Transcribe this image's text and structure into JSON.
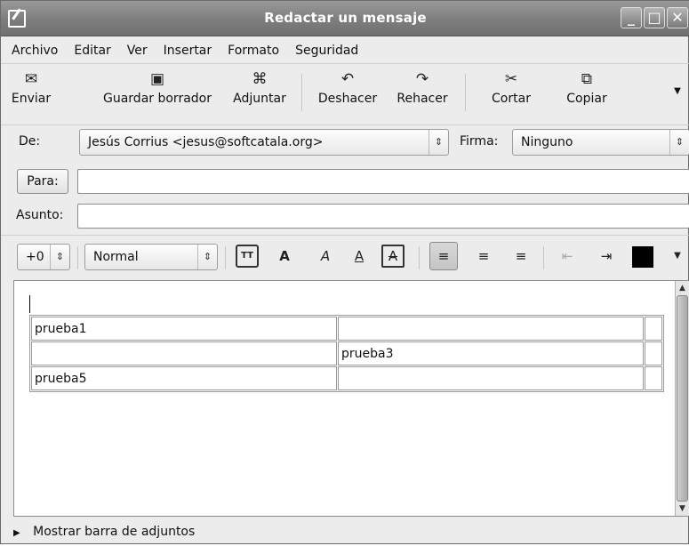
{
  "window": {
    "title": "Redactar un mensaje",
    "controls": {
      "minimize": "_",
      "maximize": "□",
      "close": "✕"
    }
  },
  "menu": [
    "Archivo",
    "Editar",
    "Ver",
    "Insertar",
    "Formato",
    "Seguridad"
  ],
  "toolbar": {
    "send": "Enviar",
    "save_draft": "Guardar borrador",
    "attach": "Adjuntar",
    "undo": "Deshacer",
    "redo": "Rehacer",
    "cut": "Cortar",
    "copy": "Copiar"
  },
  "header": {
    "from_label": "De:",
    "from_value": "Jesús Corrius <jesus@softcatala.org>",
    "signature_label": "Firma:",
    "signature_value": "Ninguno",
    "to_label": "Para:",
    "to_value": "",
    "subject_label": "Asunto:",
    "subject_value": ""
  },
  "format": {
    "size_value": "+0",
    "style_value": "Normal",
    "text_color": "#000000"
  },
  "editor": {
    "table_rows": [
      [
        "prueba1",
        "",
        ""
      ],
      [
        "",
        "prueba3",
        ""
      ],
      [
        "prueba5",
        "",
        ""
      ]
    ]
  },
  "footer": {
    "show_attachments": "Mostrar barra de adjuntos"
  },
  "icons": [
    "window-icon",
    "send-icon",
    "save-icon",
    "attach-icon",
    "undo-icon",
    "redo-icon",
    "cut-icon",
    "copy-icon",
    "overflow-chevron-icon",
    "expand-triangle-icon"
  ]
}
